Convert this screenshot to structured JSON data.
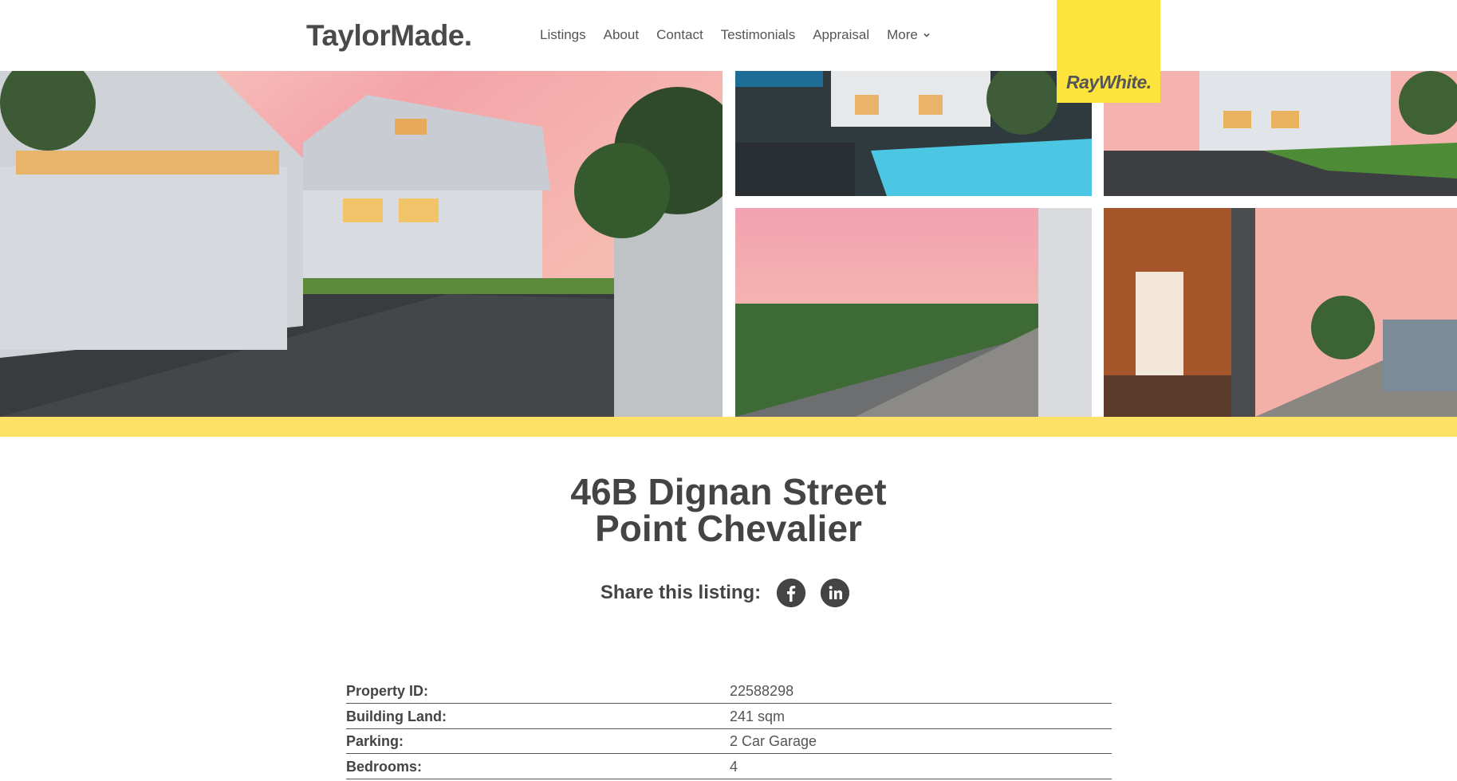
{
  "header": {
    "logo": "TaylorMade.",
    "nav": [
      {
        "label": "Listings"
      },
      {
        "label": "About"
      },
      {
        "label": "Contact"
      },
      {
        "label": "Testimonials"
      },
      {
        "label": "Appraisal"
      },
      {
        "label": "More"
      }
    ],
    "brand_badge": "RayWhite."
  },
  "gallery": {
    "images": [
      {
        "icon": "house-exterior-driveway-photo"
      },
      {
        "icon": "pool-patio-photo"
      },
      {
        "icon": "house-rear-lawn-photo"
      },
      {
        "icon": "deck-view-photo"
      },
      {
        "icon": "interior-deck-photo"
      }
    ]
  },
  "listing": {
    "address_line1": "46B Dignan Street",
    "address_line2": "Point Chevalier",
    "share_label": "Share this listing:",
    "share_icons": [
      "facebook-icon",
      "linkedin-icon"
    ],
    "details": [
      {
        "label": "Property ID:",
        "value": "22588298"
      },
      {
        "label": "Building Land:",
        "value": "241 sqm"
      },
      {
        "label": "Parking:",
        "value": "2 Car Garage"
      },
      {
        "label": "Bedrooms:",
        "value": "4"
      }
    ]
  },
  "colors": {
    "accent_yellow": "#fde43c",
    "bar_yellow": "#fde166",
    "text_dark": "#444444"
  }
}
